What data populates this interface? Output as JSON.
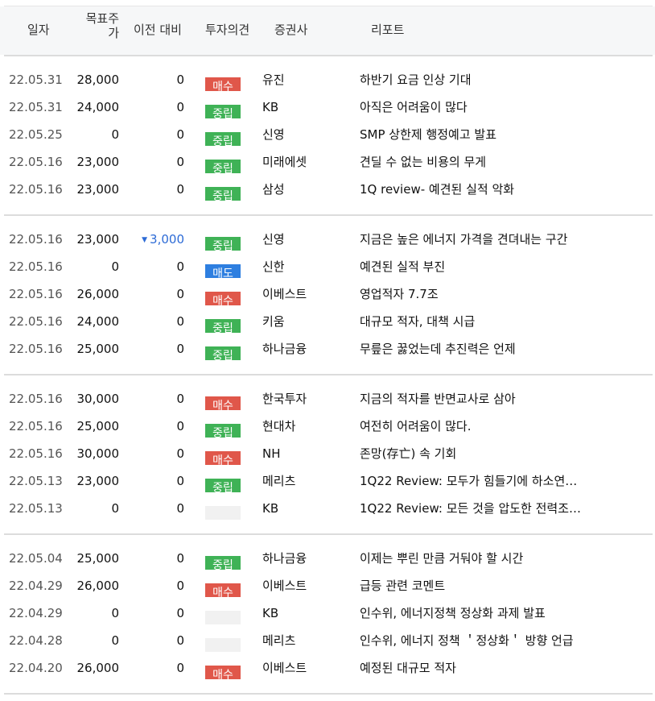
{
  "header": {
    "date": "일자",
    "target_line1": "목표주",
    "target_line2": "가",
    "prev": "이전 대비",
    "opinion": "투자의견",
    "firm": "증권사",
    "report": "리포트"
  },
  "colors": {
    "buy": "#e0574a",
    "hold": "#3fb256",
    "sell": "#2e7fe0",
    "none": "#f1f1f1",
    "down": "#2d6bd6"
  },
  "rows": [
    {
      "date": "22.05.31",
      "target": "28,000",
      "prev": "0",
      "opinion": "매수",
      "op_type": "buy",
      "firm": "유진",
      "report": "하반기 요금 인상 기대"
    },
    {
      "date": "22.05.31",
      "target": "24,000",
      "prev": "0",
      "opinion": "중립",
      "op_type": "hold",
      "firm": "KB",
      "report": "아직은 어려움이 많다"
    },
    {
      "date": "22.05.25",
      "target": "0",
      "prev": "0",
      "opinion": "중립",
      "op_type": "hold",
      "firm": "신영",
      "report": "SMP 상한제 행정예고 발표"
    },
    {
      "date": "22.05.16",
      "target": "23,000",
      "prev": "0",
      "opinion": "중립",
      "op_type": "hold",
      "firm": "미래에셋",
      "report": "견딜 수 없는 비용의 무게"
    },
    {
      "date": "22.05.16",
      "target": "23,000",
      "prev": "0",
      "opinion": "중립",
      "op_type": "hold",
      "firm": "삼성",
      "report": "1Q review- 예견된 실적 악화"
    },
    {
      "date": "22.05.16",
      "target": "23,000",
      "prev": "3,000",
      "prev_arrow": "▼",
      "opinion": "중립",
      "op_type": "hold",
      "firm": "신영",
      "report": "지금은 높은 에너지 가격을 견뎌내는 구간"
    },
    {
      "date": "22.05.16",
      "target": "0",
      "prev": "0",
      "opinion": "매도",
      "op_type": "sell",
      "firm": "신한",
      "report": "예견된 실적 부진"
    },
    {
      "date": "22.05.16",
      "target": "26,000",
      "prev": "0",
      "opinion": "매수",
      "op_type": "buy",
      "firm": "이베스트",
      "report": "영업적자 7.7조"
    },
    {
      "date": "22.05.16",
      "target": "24,000",
      "prev": "0",
      "opinion": "중립",
      "op_type": "hold",
      "firm": "키움",
      "report": "대규모 적자, 대책 시급"
    },
    {
      "date": "22.05.16",
      "target": "25,000",
      "prev": "0",
      "opinion": "중립",
      "op_type": "hold",
      "firm": "하나금융",
      "report": "무릎은 꿇었는데 추진력은 언제"
    },
    {
      "date": "22.05.16",
      "target": "30,000",
      "prev": "0",
      "opinion": "매수",
      "op_type": "buy",
      "firm": "한국투자",
      "report": "지금의 적자를 반면교사로 삼아"
    },
    {
      "date": "22.05.16",
      "target": "25,000",
      "prev": "0",
      "opinion": "중립",
      "op_type": "hold",
      "firm": "현대차",
      "report": "여전히 어려움이 많다."
    },
    {
      "date": "22.05.16",
      "target": "30,000",
      "prev": "0",
      "opinion": "매수",
      "op_type": "buy",
      "firm": "NH",
      "report": "존망(存亡) 속 기회"
    },
    {
      "date": "22.05.13",
      "target": "23,000",
      "prev": "0",
      "opinion": "중립",
      "op_type": "hold",
      "firm": "메리츠",
      "report": "1Q22 Review: 모두가 힘들기에 하소연…"
    },
    {
      "date": "22.05.13",
      "target": "0",
      "prev": "0",
      "opinion": "",
      "op_type": "none",
      "firm": "KB",
      "report": "1Q22 Review: 모든 것을 압도한 전력조…"
    },
    {
      "date": "22.05.04",
      "target": "25,000",
      "prev": "0",
      "opinion": "중립",
      "op_type": "hold",
      "firm": "하나금융",
      "report": "이제는 뿌린 만큼 거둬야 할 시간"
    },
    {
      "date": "22.04.29",
      "target": "26,000",
      "prev": "0",
      "opinion": "매수",
      "op_type": "buy",
      "firm": "이베스트",
      "report": "급등 관련 코멘트"
    },
    {
      "date": "22.04.29",
      "target": "0",
      "prev": "0",
      "opinion": "",
      "op_type": "none",
      "firm": "KB",
      "report": "인수위, 에너지정책 정상화 과제 발표"
    },
    {
      "date": "22.04.28",
      "target": "0",
      "prev": "0",
      "opinion": "",
      "op_type": "none",
      "firm": "메리츠",
      "report": "인수위, 에너지 정책 ＇정상화＇ 방향 언급"
    },
    {
      "date": "22.04.20",
      "target": "26,000",
      "prev": "0",
      "opinion": "매수",
      "op_type": "buy",
      "firm": "이베스트",
      "report": "예정된 대규모 적자"
    }
  ]
}
